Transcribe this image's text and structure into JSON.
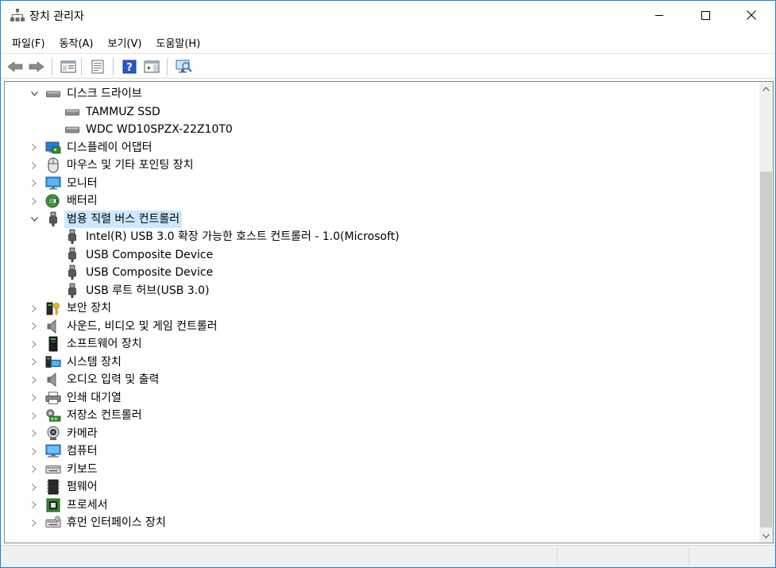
{
  "window": {
    "title": "장치 관리자"
  },
  "menu": [
    {
      "label": "파일(F)"
    },
    {
      "label": "동작(A)"
    },
    {
      "label": "보기(V)"
    },
    {
      "label": "도움말(H)"
    }
  ],
  "toolbar": {
    "icons": [
      "back-icon",
      "forward-icon",
      "show-hide-console-tree-icon",
      "properties-icon",
      "help-icon",
      "action-pane-icon",
      "scan-hardware-icon"
    ]
  },
  "tree": {
    "nodes": [
      {
        "label": "디스크 드라이브",
        "level": 0,
        "expanded": true,
        "icon": "disk-drive-icon"
      },
      {
        "label": "TAMMUZ SSD",
        "level": 1,
        "icon": "disk-drive-icon"
      },
      {
        "label": "WDC WD10SPZX-22Z10T0",
        "level": 1,
        "icon": "disk-drive-icon"
      },
      {
        "label": "디스플레이 어댑터",
        "level": 0,
        "expanded": false,
        "icon": "display-adapter-icon"
      },
      {
        "label": "마우스 및 기타 포인팅 장치",
        "level": 0,
        "expanded": false,
        "icon": "mouse-icon"
      },
      {
        "label": "모니터",
        "level": 0,
        "expanded": false,
        "icon": "monitor-icon"
      },
      {
        "label": "배터리",
        "level": 0,
        "expanded": false,
        "icon": "battery-icon"
      },
      {
        "label": "범용 직렬 버스 컨트롤러",
        "level": 0,
        "expanded": true,
        "selected": true,
        "icon": "usb-icon"
      },
      {
        "label": "Intel(R) USB 3.0 확장 가능한 호스트 컨트롤러 - 1.0(Microsoft)",
        "level": 1,
        "icon": "usb-icon"
      },
      {
        "label": "USB Composite Device",
        "level": 1,
        "icon": "usb-icon"
      },
      {
        "label": "USB Composite Device",
        "level": 1,
        "icon": "usb-icon"
      },
      {
        "label": "USB 루트 허브(USB 3.0)",
        "level": 1,
        "icon": "usb-icon"
      },
      {
        "label": "보안 장치",
        "level": 0,
        "expanded": false,
        "icon": "security-device-icon"
      },
      {
        "label": "사운드, 비디오 및 게임 컨트롤러",
        "level": 0,
        "expanded": false,
        "icon": "speaker-icon"
      },
      {
        "label": "소프트웨어 장치",
        "level": 0,
        "expanded": false,
        "icon": "software-device-icon"
      },
      {
        "label": "시스템 장치",
        "level": 0,
        "expanded": false,
        "icon": "system-device-icon"
      },
      {
        "label": "오디오 입력 및 출력",
        "level": 0,
        "expanded": false,
        "icon": "speaker-icon"
      },
      {
        "label": "인쇄 대기열",
        "level": 0,
        "expanded": false,
        "icon": "printer-icon"
      },
      {
        "label": "저장소 컨트롤러",
        "level": 0,
        "expanded": false,
        "icon": "storage-controller-icon"
      },
      {
        "label": "카메라",
        "level": 0,
        "expanded": false,
        "icon": "camera-icon"
      },
      {
        "label": "컴퓨터",
        "level": 0,
        "expanded": false,
        "icon": "computer-icon"
      },
      {
        "label": "키보드",
        "level": 0,
        "expanded": false,
        "icon": "keyboard-icon"
      },
      {
        "label": "펌웨어",
        "level": 0,
        "expanded": false,
        "icon": "firmware-icon"
      },
      {
        "label": "프로세서",
        "level": 0,
        "expanded": false,
        "icon": "processor-icon"
      },
      {
        "label": "휴먼 인터페이스 장치",
        "level": 0,
        "expanded": false,
        "icon": "hid-icon"
      }
    ]
  },
  "colors": {
    "selection": "#cce8ff",
    "window_border": "#1883d7",
    "scrollbar_thumb": "#cdcdcd"
  }
}
